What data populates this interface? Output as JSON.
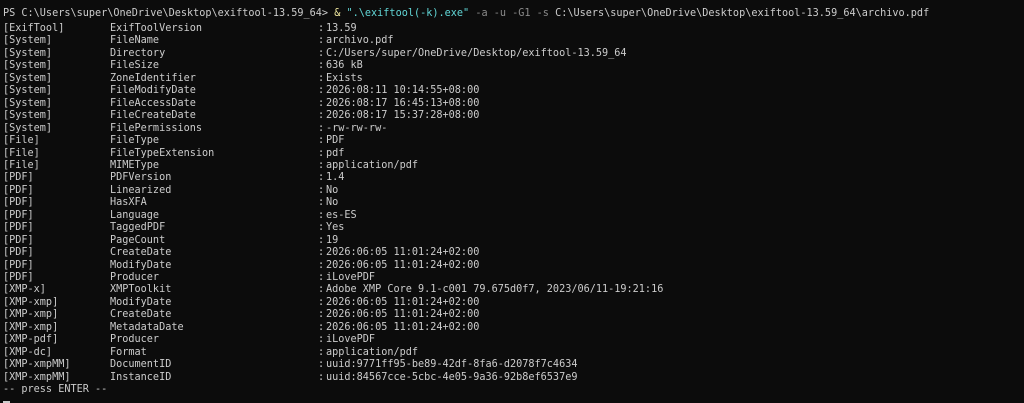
{
  "terminal": {
    "prompt": "PS C:\\Users\\super\\OneDrive\\Desktop\\exiftool-13.59_64>",
    "operator": "&",
    "exe_string": "\".\\exiftool(-k).exe\"",
    "args": "-a -u -G1 -s",
    "file_path": "C:\\Users\\super\\OneDrive\\Desktop\\exiftool-13.59_64\\archivo.pdf",
    "separator": ":",
    "footer": "-- press ENTER --"
  },
  "rows": [
    {
      "group": "[ExifTool]",
      "tag": "ExifToolVersion",
      "value": "13.59"
    },
    {
      "group": "[System]",
      "tag": "FileName",
      "value": "archivo.pdf"
    },
    {
      "group": "[System]",
      "tag": "Directory",
      "value": "C:/Users/super/OneDrive/Desktop/exiftool-13.59_64"
    },
    {
      "group": "[System]",
      "tag": "FileSize",
      "value": "636 kB"
    },
    {
      "group": "[System]",
      "tag": "ZoneIdentifier",
      "value": "Exists"
    },
    {
      "group": "[System]",
      "tag": "FileModifyDate",
      "value": "2026:08:11 10:14:55+08:00"
    },
    {
      "group": "[System]",
      "tag": "FileAccessDate",
      "value": "2026:08:17 16:45:13+08:00"
    },
    {
      "group": "[System]",
      "tag": "FileCreateDate",
      "value": "2026:08:17 15:37:28+08:00"
    },
    {
      "group": "[System]",
      "tag": "FilePermissions",
      "value": "-rw-rw-rw-"
    },
    {
      "group": "[File]",
      "tag": "FileType",
      "value": "PDF"
    },
    {
      "group": "[File]",
      "tag": "FileTypeExtension",
      "value": "pdf"
    },
    {
      "group": "[File]",
      "tag": "MIMEType",
      "value": "application/pdf"
    },
    {
      "group": "[PDF]",
      "tag": "PDFVersion",
      "value": "1.4"
    },
    {
      "group": "[PDF]",
      "tag": "Linearized",
      "value": "No"
    },
    {
      "group": "[PDF]",
      "tag": "HasXFA",
      "value": "No"
    },
    {
      "group": "[PDF]",
      "tag": "Language",
      "value": "es-ES"
    },
    {
      "group": "[PDF]",
      "tag": "TaggedPDF",
      "value": "Yes"
    },
    {
      "group": "[PDF]",
      "tag": "PageCount",
      "value": "19"
    },
    {
      "group": "[PDF]",
      "tag": "CreateDate",
      "value": "2026:06:05 11:01:24+02:00"
    },
    {
      "group": "[PDF]",
      "tag": "ModifyDate",
      "value": "2026:06:05 11:01:24+02:00"
    },
    {
      "group": "[PDF]",
      "tag": "Producer",
      "value": "iLovePDF"
    },
    {
      "group": "[XMP-x]",
      "tag": "XMPToolkit",
      "value": "Adobe XMP Core 9.1-c001 79.675d0f7, 2023/06/11-19:21:16"
    },
    {
      "group": "[XMP-xmp]",
      "tag": "ModifyDate",
      "value": "2026:06:05 11:01:24+02:00"
    },
    {
      "group": "[XMP-xmp]",
      "tag": "CreateDate",
      "value": "2026:06:05 11:01:24+02:00"
    },
    {
      "group": "[XMP-xmp]",
      "tag": "MetadataDate",
      "value": "2026:06:05 11:01:24+02:00"
    },
    {
      "group": "[XMP-pdf]",
      "tag": "Producer",
      "value": "iLovePDF"
    },
    {
      "group": "[XMP-dc]",
      "tag": "Format",
      "value": "application/pdf"
    },
    {
      "group": "[XMP-xmpMM]",
      "tag": "DocumentID",
      "value": "uuid:9771ff95-be89-42df-8fa6-d2078f7c4634"
    },
    {
      "group": "[XMP-xmpMM]",
      "tag": "InstanceID",
      "value": "uuid:84567cce-5cbc-4e05-9a36-92b8ef6537e9"
    }
  ],
  "colors": {
    "background": "#0c0c0c",
    "foreground": "#cccccc",
    "exe": "#f9f1a5",
    "string": "#61d6d6",
    "args": "#8a8a8a"
  }
}
